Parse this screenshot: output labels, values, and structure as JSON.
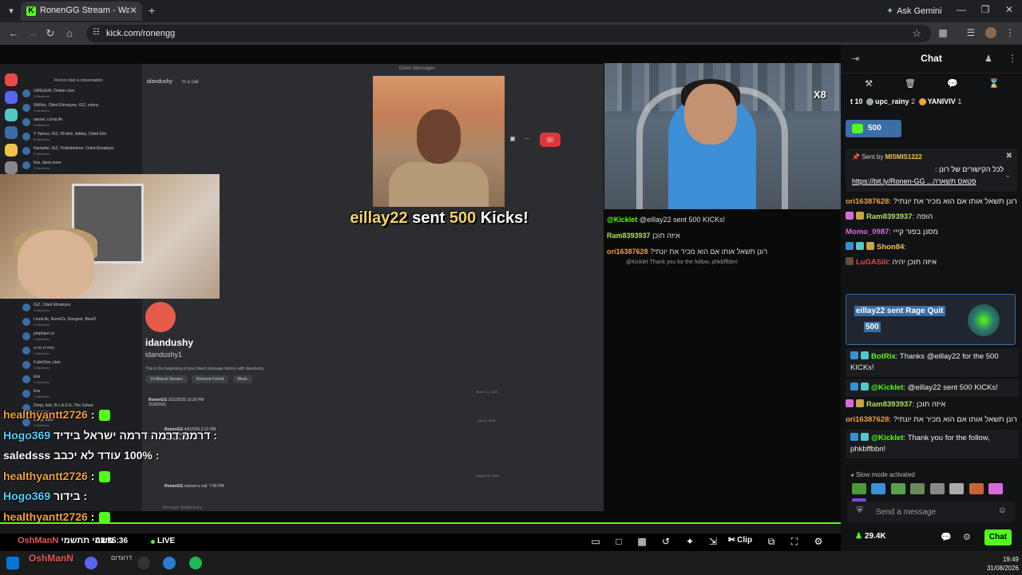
{
  "browser": {
    "tab_title": "RonenGG Stream - Watch Live o",
    "ask_gemini": "Ask Gemini",
    "url": "kick.com/ronengg"
  },
  "stream": {
    "dm_header": "Direct Messages",
    "find_conversation": "Find or start a conversation",
    "dm_items": [
      {
        "name": "UkMoZeN, Delete User",
        "sub": "3 Members"
      },
      {
        "name": "ShiNzz, Oded Elmakyes, IGZ, edenz",
        "sub": "5 Members"
      },
      {
        "name": "sansei, LiorsLife",
        "sub": "3 Members"
      },
      {
        "name": "Y Yarinoi, IGZ, KFafnir, Adidar, Oded Elm",
        "sub": "8 Members"
      },
      {
        "name": "Hamuttzi, IGZ, Pedrofederer, Oded Elmakyes",
        "sub": "5 Members"
      },
      {
        "name": "kira, dana more",
        "sub": "3 Members"
      }
    ],
    "dm_items_lower": [
      {
        "name": "IGZ, Oded Elmakyes",
        "sub": "3 Members"
      },
      {
        "name": "LiorsLife, RomiiZz, Dangoor, BlueD",
        "sub": "5 Members"
      },
      {
        "name": "pmphant cs",
        "sub": "3 Members"
      },
      {
        "name": "מסירת מידע",
        "sub": "3 Members"
      },
      {
        "name": "FubinSon, idan",
        "sub": "3 Members"
      },
      {
        "name": "kira",
        "sub": "3 Members"
      },
      {
        "name": "kira",
        "sub": "3 Members"
      },
      {
        "name": "Dorjq, bob, B.L.A.D.E, The Zuhan",
        "sub": "5 Members"
      },
      {
        "name": "Dorja, Idan",
        "sub": "3 Members"
      }
    ],
    "call_user": "idandushy",
    "call_status": "In a call",
    "alert_user": "eillay22",
    "alert_mid": "sent",
    "alert_amount": "500",
    "alert_end": "Kicks!",
    "x8": "X8",
    "stream_chat": [
      {
        "user": "@Kicklet",
        "text": "@eillay22 sent 500 KICKs!",
        "color": "#53fc18"
      },
      {
        "user": "Ram8393937",
        "text": "איזה תוכן",
        "color": "#b3e05a"
      },
      {
        "user": "ori16387628",
        "text": "רונן תשאל אותו אם הוא מכיר את יונתי?",
        "color": "#f0a23a"
      }
    ],
    "stream_chat_small": "@Kicklet Thank you for the follow, phkbffbbn!",
    "dm_profile_name": "idandushy",
    "dm_profile_handle": "idandushy1",
    "dm_begin": "This is the beginning of your direct message history with idandushy.",
    "dm_mutual": "10 Mutual Servers",
    "dm_remove": "Remove Friend",
    "dm_block": "Block",
    "dm_date1": "March 11, 2026",
    "dm_msg1_user": "RonenGG",
    "dm_msg1_time": "3/11/2026 10:25 PM",
    "dm_msg1_text": "ZGNODG",
    "dm_date2": "April 6, 2026",
    "dm_msg2_user": "RonenGG",
    "dm_msg2_time": "4/6/2026 2:13 PM",
    "dm_msg2_text1": "code among us",
    "dm_msg2_text2": "and crew link",
    "dm_date3": "August 31, 2026",
    "dm_msg3_user": "RonenGG",
    "dm_msg3_text": "started a call.",
    "dm_msg3_time": "7:46 PM",
    "dm_input": "Message @idandushy",
    "overlay_chat": [
      {
        "user": "healthyantt2726",
        "text": ":",
        "emote": true,
        "ucls": "u"
      },
      {
        "user": "Hogo369",
        "text": ": דרמה דרמה דרמה ישראל בידיד",
        "emote": false,
        "ucls": "u2"
      },
      {
        "user": "saledsss",
        "text": ": 100% עודד לא יכבב",
        "emote": false,
        "ucls": "u3"
      },
      {
        "user": "healthyantt2726",
        "text": ":",
        "emote": true,
        "ucls": "u"
      },
      {
        "user": "Hogo369",
        "text": ": בידור",
        "emote": false,
        "ucls": "u2"
      },
      {
        "user": "healthyantt2726",
        "text": ":",
        "emote": true,
        "ucls": "u"
      }
    ],
    "bottom_overlay_user": "OshManN",
    "bottom_overlay_text": "משהי תתשמי",
    "taskbar_left_text": "דרוגדום"
  },
  "player": {
    "time": "03:55:36",
    "live": "LIVE",
    "clip": "Clip"
  },
  "chat": {
    "title": "Chat",
    "gifters": [
      {
        "name": "t 10",
        "count": ""
      },
      {
        "name": "upc_rainy",
        "count": "2"
      },
      {
        "name": "YANIVIV",
        "count": "1"
      }
    ],
    "kick_pill": "500",
    "pinned_sentby": "Sent by",
    "pinned_user": "MISMIS1222",
    "pinned_msg": "לכל הקישורים של רונן :",
    "pinned_link": "https://bit.ly/Ronen-GG ...פטאס תשארה",
    "lines": [
      {
        "user": "ori16387628",
        "sep": ":",
        "text": "רונן תשאל אותו אם הוא מכיר את יונתי?",
        "color": "#f0a23a",
        "badges": []
      },
      {
        "user": "Ram8393937",
        "sep": ":",
        "text": "הופה",
        "color": "#b3e05a",
        "badges": [
          "#d96bd9",
          "#c8a44a"
        ]
      },
      {
        "user": "Momo_0987",
        "sep": ":",
        "text": "מסנן בפור קייי",
        "color": "#d96bd9",
        "badges": []
      },
      {
        "user": "Shon84",
        "sep": ":",
        "text": "",
        "color": "#f0c24a",
        "badges": [
          "#3a8fd6",
          "#53c8c8",
          "#c8a44a"
        ]
      },
      {
        "user": "LuGASili",
        "sep": ":",
        "text": "איזה תוכן יהיה",
        "color": "#e84a4a",
        "badges": [
          "#6a4a3a"
        ]
      }
    ],
    "sub_line1": "eillay22 sent Rage Quit",
    "sub_line2": "500",
    "lines2": [
      {
        "user": "BotRix",
        "sep": ":",
        "text": "Thanks @eillay22 for the 500 KICKs!",
        "color": "#53fc18",
        "boxed": true,
        "badges": [
          "#3a8fd6",
          "#53c8c8"
        ]
      },
      {
        "user": "@Kicklet",
        "sep": ":",
        "text": "@eillay22 sent 500 KICKs!",
        "color": "#53fc18",
        "boxed": true,
        "badges": [
          "#3a8fd6",
          "#53c8c8"
        ]
      },
      {
        "user": "Ram8393937",
        "sep": ":",
        "text": "איזה תוכן",
        "color": "#b3e05a",
        "boxed": false,
        "badges": [
          "#d96bd9",
          "#c8a44a"
        ]
      },
      {
        "user": "ori16387628",
        "sep": ":",
        "text": "רונן תשאל אותו אם הוא מכיר את יונתי?",
        "color": "#f0a23a",
        "boxed": false,
        "badges": []
      },
      {
        "user": "@Kicklet",
        "sep": ":",
        "text": "Thank you for the follow, phkbffbbn!",
        "color": "#53fc18",
        "boxed": true,
        "badges": [
          "#3a8fd6",
          "#53c8c8"
        ]
      }
    ],
    "slow_mode": "Slow mode activated",
    "send_placeholder": "Send a message",
    "viewers": "29.4K",
    "chat_button": "Chat"
  },
  "taskbar": {
    "time": "19:49",
    "date": "31/08/2026",
    "overlay_name": "OshManN"
  }
}
